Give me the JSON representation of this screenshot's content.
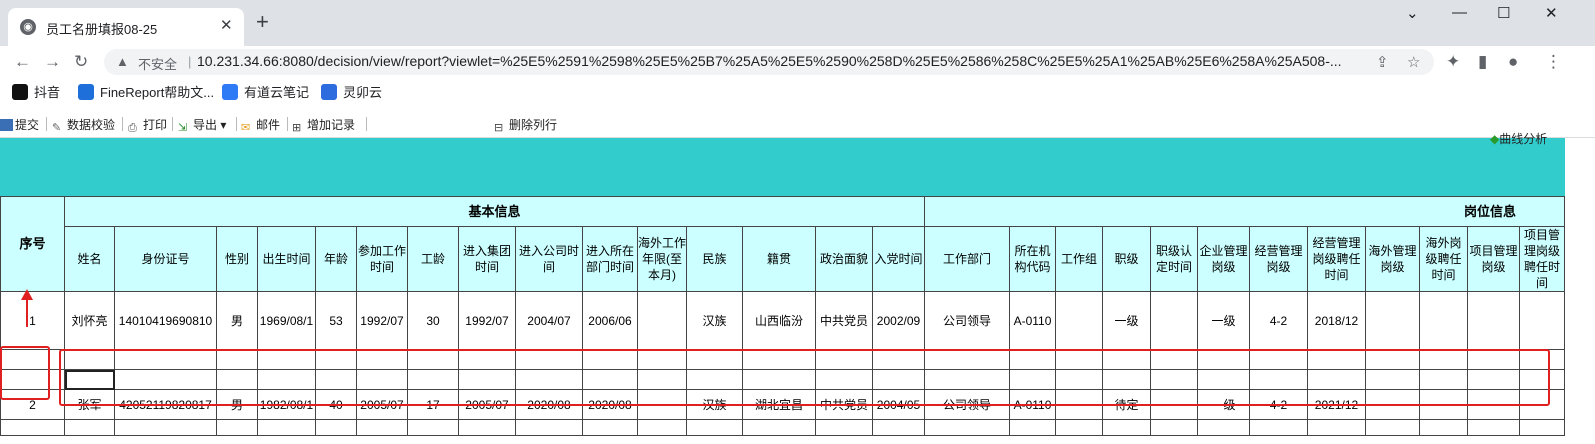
{
  "browser": {
    "tab_title": "员工名册填报08-25",
    "tab_icon": "globe-icon",
    "new_tab": "+",
    "close": "✕",
    "insecure_label": "不安全",
    "separator": "|",
    "url": "10.231.34.66:8080/decision/view/report?viewlet=%25E5%2591%2598%25E5%25B7%25A5%25E5%2590%258D%25E5%2586%258C%25E5%25A1%25AB%25E6%258A%25A508-..."
  },
  "bookmarks": [
    {
      "label": "抖音",
      "color": "#111111"
    },
    {
      "label": "FineReport帮助文...",
      "color": "#1e6fd9"
    },
    {
      "label": "有道云笔记",
      "color": "#2f7bf5"
    },
    {
      "label": "灵卯云",
      "color": "#2d6cdf"
    }
  ],
  "toolbar": {
    "submit": "提交",
    "verify": "数据校验",
    "print": "打印",
    "export": "导出",
    "mail": "邮件",
    "add_row": "增加记录",
    "delete_row": "删除列行",
    "curve": "曲线分析"
  },
  "table": {
    "seq_header": "序号",
    "group_basic": "基本信息",
    "group_post": "岗位信息",
    "headers": [
      "姓名",
      "身份证号",
      "性别",
      "出生时间",
      "年龄",
      "参加工作时间",
      "工龄",
      "进入集团时间",
      "进入公司时间",
      "进入所在部门时间",
      "海外工作年限(至本月)",
      "民族",
      "籍贯",
      "政治面貌",
      "入党时间",
      "工作部门",
      "所在机构代码",
      "工作组",
      "职级",
      "职级认定时间",
      "企业管理岗级",
      "经营管理岗级",
      "经营管理岗级聘任时间",
      "海外管理岗级",
      "海外岗级聘任时间",
      "项目管理岗级",
      "项目管理岗级聘任时间"
    ],
    "rows": [
      {
        "seq": "1",
        "cells": [
          "刘怀亮",
          "14010419690810",
          "男",
          "1969/08/1",
          "53",
          "1992/07",
          "30",
          "1992/07",
          "2004/07",
          "2006/06",
          "",
          "汉族",
          "山西临汾",
          "中共党员",
          "2002/09",
          "公司领导",
          "A-0110",
          "",
          "一级",
          "",
          "一级",
          "4-2",
          "2018/12",
          "",
          "",
          "",
          ""
        ]
      },
      {
        "seq": "",
        "cells": [
          "",
          "",
          "",
          "",
          "",
          "",
          "",
          "",
          "",
          "",
          "",
          "",
          "",
          "",
          "",
          "",
          "",
          "",
          "",
          "",
          "",
          "",
          "",
          "",
          "",
          "",
          ""
        ]
      },
      {
        "seq": "",
        "cells": [
          "",
          "",
          "",
          "",
          "",
          "",
          "",
          "",
          "",
          "",
          "",
          "",
          "",
          "",
          "",
          "",
          "",
          "",
          "",
          "",
          "",
          "",
          "",
          "",
          "",
          "",
          ""
        ]
      },
      {
        "seq": "2",
        "cells": [
          "张军",
          "42052119820817",
          "男",
          "1982/08/1",
          "40",
          "2005/07",
          "17",
          "2005/07",
          "2020/08",
          "2020/08",
          "",
          "汉族",
          "湖北宜昌",
          "中共党员",
          "2004/05",
          "公司领导",
          "A-0110",
          "",
          "待定",
          "",
          "一级",
          "4-2",
          "2021/12",
          "",
          "",
          "",
          ""
        ]
      },
      {
        "seq": "",
        "cells": [
          "",
          "",
          "",
          "",
          "",
          "",
          "",
          "",
          "",
          "",
          "",
          "",
          "",
          "",
          "",
          "",
          "",
          "",
          "",
          "",
          "",
          "",
          "",
          "",
          "",
          "",
          ""
        ]
      }
    ]
  },
  "colors": {
    "banner": "#33cccc",
    "header_bg": "#ccffff",
    "highlight": "#e02020"
  }
}
